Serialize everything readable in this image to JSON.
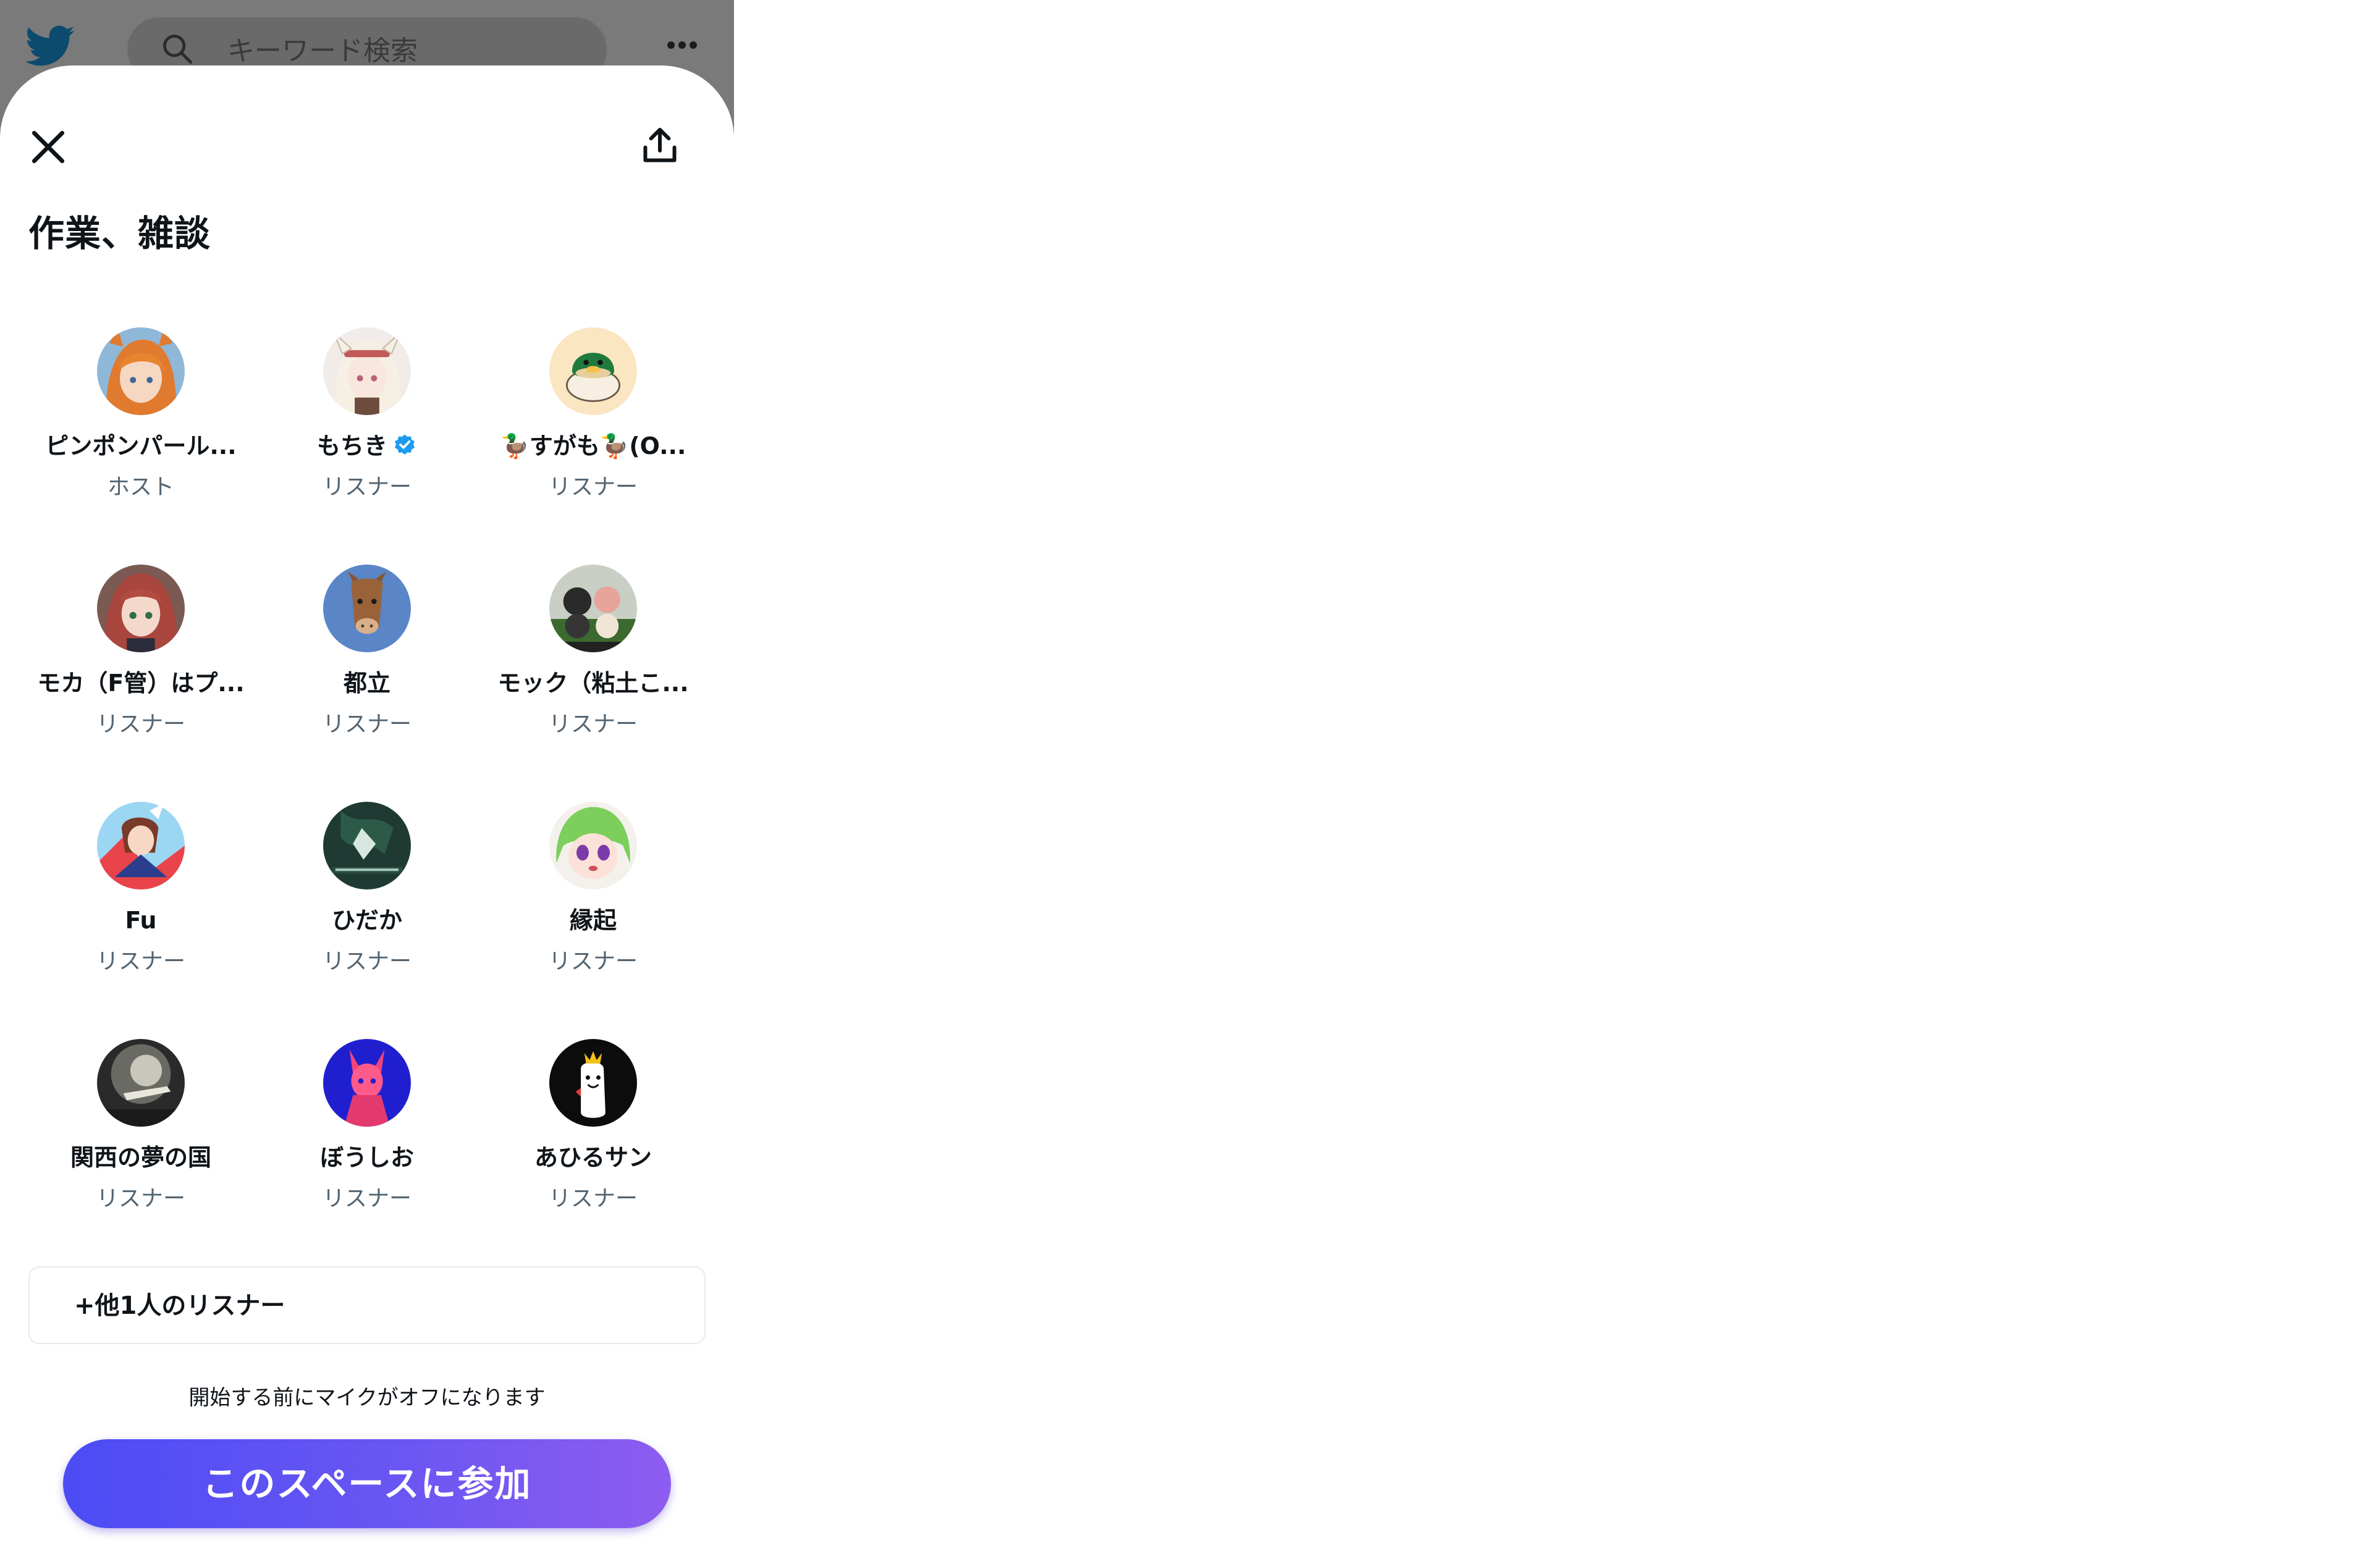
{
  "header": {
    "search_placeholder": "キーワード検索"
  },
  "space": {
    "title": "作業、雑談",
    "participants": [
      {
        "name": "ピンポンパール...",
        "role": "ホスト",
        "verified": false,
        "avatar": "anime-girl-orange-hair"
      },
      {
        "name": "もちき",
        "role": "リスナー",
        "verified": true,
        "avatar": "anime-girl-white-hair"
      },
      {
        "name": "🦆すがも🦆(O...",
        "role": "リスナー",
        "verified": false,
        "avatar": "duck-mochi"
      },
      {
        "name": "モカ（F管）はプ...",
        "role": "リスナー",
        "verified": false,
        "avatar": "anime-girl-red-hair"
      },
      {
        "name": "都立",
        "role": "リスナー",
        "verified": false,
        "avatar": "horse-face"
      },
      {
        "name": "モック（粘土こ...",
        "role": "リスナー",
        "verified": false,
        "avatar": "clay-figures"
      },
      {
        "name": "Fu",
        "role": "リスナー",
        "verified": false,
        "avatar": "uma-musume-fan-art"
      },
      {
        "name": "ひだか",
        "role": "リスナー",
        "verified": false,
        "avatar": "king-of-emerald"
      },
      {
        "name": "縁起",
        "role": "リスナー",
        "verified": false,
        "avatar": "green-hair-chibi"
      },
      {
        "name": "関西の夢の国",
        "role": "リスナー",
        "verified": false,
        "avatar": "night-light-photo"
      },
      {
        "name": "ぼうしお",
        "role": "リスナー",
        "verified": false,
        "avatar": "pink-character-blue-bg"
      },
      {
        "name": "あひるサン",
        "role": "リスナー",
        "verified": false,
        "avatar": "white-duck-crown"
      }
    ],
    "more_listeners": "+他1人のリスナー",
    "mic_note": "開始する前にマイクがオフになります",
    "join_label": "このスペースに参加"
  },
  "colors": {
    "accent_gradient_start": "#4b4cf5",
    "accent_gradient_end": "#8e5cf0",
    "verified": "#1d9bf0",
    "secondary_text": "#536471"
  }
}
